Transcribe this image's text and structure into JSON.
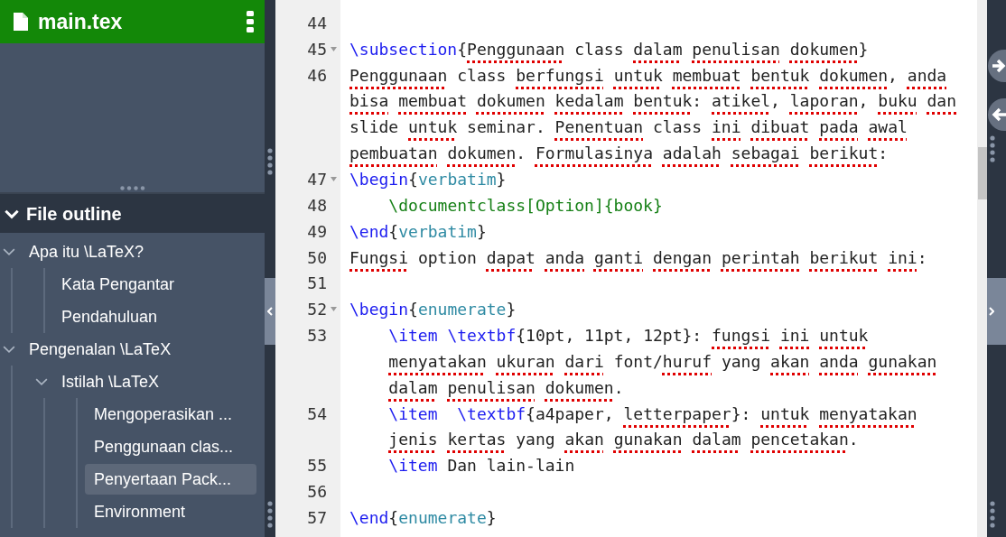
{
  "file_header": {
    "title": "main.tex"
  },
  "outline": {
    "title": "File outline",
    "expanded": true,
    "items": [
      {
        "label": "Apa itu \\LaTeX?",
        "expanded": true,
        "selected": false,
        "children": [
          {
            "label": "Kata Pengantar",
            "selected": false
          },
          {
            "label": "Pendahuluan",
            "selected": false
          }
        ]
      },
      {
        "label": "Pengenalan \\LaTeX",
        "expanded": true,
        "selected": false,
        "children": [
          {
            "label": "Istilah \\LaTeX",
            "expanded": true,
            "selected": false,
            "children": [
              {
                "label": "Mengoperasikan ...",
                "selected": false
              },
              {
                "label": "Penggunaan clas...",
                "selected": false
              },
              {
                "label": "Penyertaan Pack...",
                "selected": true
              },
              {
                "label": "Environment",
                "selected": false
              }
            ]
          }
        ]
      }
    ]
  },
  "editor": {
    "lines": [
      {
        "number": "44",
        "foldable": false,
        "rows": [
          {}
        ]
      },
      {
        "number": "45",
        "foldable": true,
        "rows": [
          {
            "tokens": [
              {
                "text": "\\subsection",
                "kind": "cmd"
              },
              {
                "text": "{",
                "kind": "text"
              },
              {
                "text": "Penggunaan",
                "kind": "typo"
              },
              {
                "text": " class ",
                "kind": "text"
              },
              {
                "text": "dalam ",
                "kind": "typo"
              },
              {
                "text": "penulisan ",
                "kind": "typo"
              },
              {
                "text": "dokumen",
                "kind": "typo"
              },
              {
                "text": "}",
                "kind": "text"
              }
            ]
          }
        ]
      },
      {
        "number": "46",
        "foldable": false,
        "rows": [
          {
            "tokens": [
              {
                "text": "Penggunaan",
                "kind": "typo"
              },
              {
                "text": " class ",
                "kind": "text"
              },
              {
                "text": "berfungsi ",
                "kind": "typo"
              },
              {
                "text": "untuk ",
                "kind": "typo"
              },
              {
                "text": "membuat ",
                "kind": "typo"
              },
              {
                "text": "bentuk ",
                "kind": "typo"
              },
              {
                "text": "dokumen",
                "kind": "typo"
              },
              {
                "text": ", ",
                "kind": "text"
              },
              {
                "text": "anda",
                "kind": "typo"
              }
            ]
          },
          {
            "tokens": [
              {
                "text": "bisa ",
                "kind": "typo"
              },
              {
                "text": "membuat ",
                "kind": "typo"
              },
              {
                "text": "dokumen ",
                "kind": "typo"
              },
              {
                "text": "kedalam ",
                "kind": "typo"
              },
              {
                "text": "bentuk",
                "kind": "typo"
              },
              {
                "text": ": ",
                "kind": "text"
              },
              {
                "text": "atikel",
                "kind": "typo"
              },
              {
                "text": ", ",
                "kind": "text"
              },
              {
                "text": "laporan",
                "kind": "typo"
              },
              {
                "text": ", ",
                "kind": "text"
              },
              {
                "text": "buku ",
                "kind": "typo"
              },
              {
                "text": "dan",
                "kind": "typo"
              }
            ]
          },
          {
            "tokens": [
              {
                "text": "slide ",
                "kind": "text"
              },
              {
                "text": "untuk",
                "kind": "typo"
              },
              {
                "text": " seminar. ",
                "kind": "text"
              },
              {
                "text": "Penentuan",
                "kind": "typo"
              },
              {
                "text": " class ",
                "kind": "text"
              },
              {
                "text": "ini ",
                "kind": "typo"
              },
              {
                "text": "dibuat ",
                "kind": "typo"
              },
              {
                "text": "pada ",
                "kind": "typo"
              },
              {
                "text": "awal",
                "kind": "typo"
              }
            ]
          },
          {
            "tokens": [
              {
                "text": "pembuatan ",
                "kind": "typo"
              },
              {
                "text": "dokumen",
                "kind": "typo"
              },
              {
                "text": ". ",
                "kind": "text"
              },
              {
                "text": "Formulasinya ",
                "kind": "typo"
              },
              {
                "text": "adalah ",
                "kind": "typo"
              },
              {
                "text": "sebagai ",
                "kind": "typo"
              },
              {
                "text": "berikut",
                "kind": "typo"
              },
              {
                "text": ":",
                "kind": "text"
              }
            ]
          }
        ]
      },
      {
        "number": "47",
        "foldable": true,
        "rows": [
          {
            "tokens": [
              {
                "text": "\\begin",
                "kind": "cmd"
              },
              {
                "text": "{",
                "kind": "text"
              },
              {
                "text": "verbatim",
                "kind": "env"
              },
              {
                "text": "}",
                "kind": "text"
              }
            ]
          }
        ]
      },
      {
        "number": "48",
        "foldable": false,
        "rows": [
          {
            "tokens": [
              {
                "text": "    \\documentclass[Option]{book}",
                "kind": "verb"
              }
            ]
          }
        ]
      },
      {
        "number": "49",
        "foldable": false,
        "rows": [
          {
            "tokens": [
              {
                "text": "\\end",
                "kind": "cmd"
              },
              {
                "text": "{",
                "kind": "text"
              },
              {
                "text": "verbatim",
                "kind": "env"
              },
              {
                "text": "}",
                "kind": "text"
              }
            ]
          }
        ]
      },
      {
        "number": "50",
        "foldable": false,
        "rows": [
          {
            "tokens": [
              {
                "text": "Fungsi",
                "kind": "typo"
              },
              {
                "text": " option ",
                "kind": "text"
              },
              {
                "text": "dapat ",
                "kind": "typo"
              },
              {
                "text": "anda ",
                "kind": "typo"
              },
              {
                "text": "ganti ",
                "kind": "typo"
              },
              {
                "text": "dengan ",
                "kind": "typo"
              },
              {
                "text": "perintah ",
                "kind": "typo"
              },
              {
                "text": "berikut ",
                "kind": "typo"
              },
              {
                "text": "ini",
                "kind": "typo"
              },
              {
                "text": ":",
                "kind": "text"
              }
            ]
          }
        ]
      },
      {
        "number": "51",
        "foldable": false,
        "rows": [
          {}
        ]
      },
      {
        "number": "52",
        "foldable": true,
        "rows": [
          {
            "tokens": [
              {
                "text": "\\begin",
                "kind": "cmd"
              },
              {
                "text": "{",
                "kind": "text"
              },
              {
                "text": "enumerate",
                "kind": "env"
              },
              {
                "text": "}",
                "kind": "text"
              }
            ]
          }
        ]
      },
      {
        "number": "53",
        "foldable": false,
        "rows": [
          {
            "tokens": [
              {
                "text": "    \\item ",
                "kind": "cmd"
              },
              {
                "text": "\\textbf",
                "kind": "cmd"
              },
              {
                "text": "{10pt, 11pt, 12pt}: ",
                "kind": "text"
              },
              {
                "text": "fungsi ",
                "kind": "typo"
              },
              {
                "text": "ini ",
                "kind": "typo"
              },
              {
                "text": "untuk",
                "kind": "typo"
              }
            ]
          },
          {
            "tokens": [
              {
                "text": "    menyatakan ",
                "kind": "typo"
              },
              {
                "text": "ukuran ",
                "kind": "typo"
              },
              {
                "text": "dari",
                "kind": "typo"
              },
              {
                "text": " font/",
                "kind": "text"
              },
              {
                "text": "huruf",
                "kind": "typo"
              },
              {
                "text": " yang ",
                "kind": "text"
              },
              {
                "text": "akan ",
                "kind": "typo"
              },
              {
                "text": "anda ",
                "kind": "typo"
              },
              {
                "text": "gunakan",
                "kind": "typo"
              }
            ]
          },
          {
            "tokens": [
              {
                "text": "    dalam ",
                "kind": "typo"
              },
              {
                "text": "penulisan ",
                "kind": "typo"
              },
              {
                "text": "dokumen",
                "kind": "typo"
              },
              {
                "text": ".",
                "kind": "text"
              }
            ]
          }
        ]
      },
      {
        "number": "54",
        "foldable": false,
        "rows": [
          {
            "tokens": [
              {
                "text": "    \\item  ",
                "kind": "cmd"
              },
              {
                "text": "\\textbf",
                "kind": "cmd"
              },
              {
                "text": "{a4paper, ",
                "kind": "text"
              },
              {
                "text": "letterpaper",
                "kind": "typo"
              },
              {
                "text": "}: ",
                "kind": "text"
              },
              {
                "text": "untuk ",
                "kind": "typo"
              },
              {
                "text": "menyatakan",
                "kind": "typo"
              }
            ]
          },
          {
            "tokens": [
              {
                "text": "    jenis ",
                "kind": "typo"
              },
              {
                "text": "kertas",
                "kind": "typo"
              },
              {
                "text": " yang ",
                "kind": "text"
              },
              {
                "text": "akan ",
                "kind": "typo"
              },
              {
                "text": "gunakan ",
                "kind": "typo"
              },
              {
                "text": "dalam ",
                "kind": "typo"
              },
              {
                "text": "pencetakan",
                "kind": "typo"
              },
              {
                "text": ".",
                "kind": "text"
              }
            ]
          }
        ]
      },
      {
        "number": "55",
        "foldable": false,
        "rows": [
          {
            "tokens": [
              {
                "text": "    \\item",
                "kind": "cmd"
              },
              {
                "text": " Dan lain-lain",
                "kind": "text"
              }
            ]
          }
        ]
      },
      {
        "number": "56",
        "foldable": false,
        "rows": [
          {}
        ]
      },
      {
        "number": "57",
        "foldable": false,
        "rows": [
          {
            "tokens": [
              {
                "text": "\\end",
                "kind": "cmd"
              },
              {
                "text": "{",
                "kind": "text"
              },
              {
                "text": "enumerate",
                "kind": "env"
              },
              {
                "text": "}",
                "kind": "text"
              }
            ]
          }
        ]
      }
    ]
  }
}
